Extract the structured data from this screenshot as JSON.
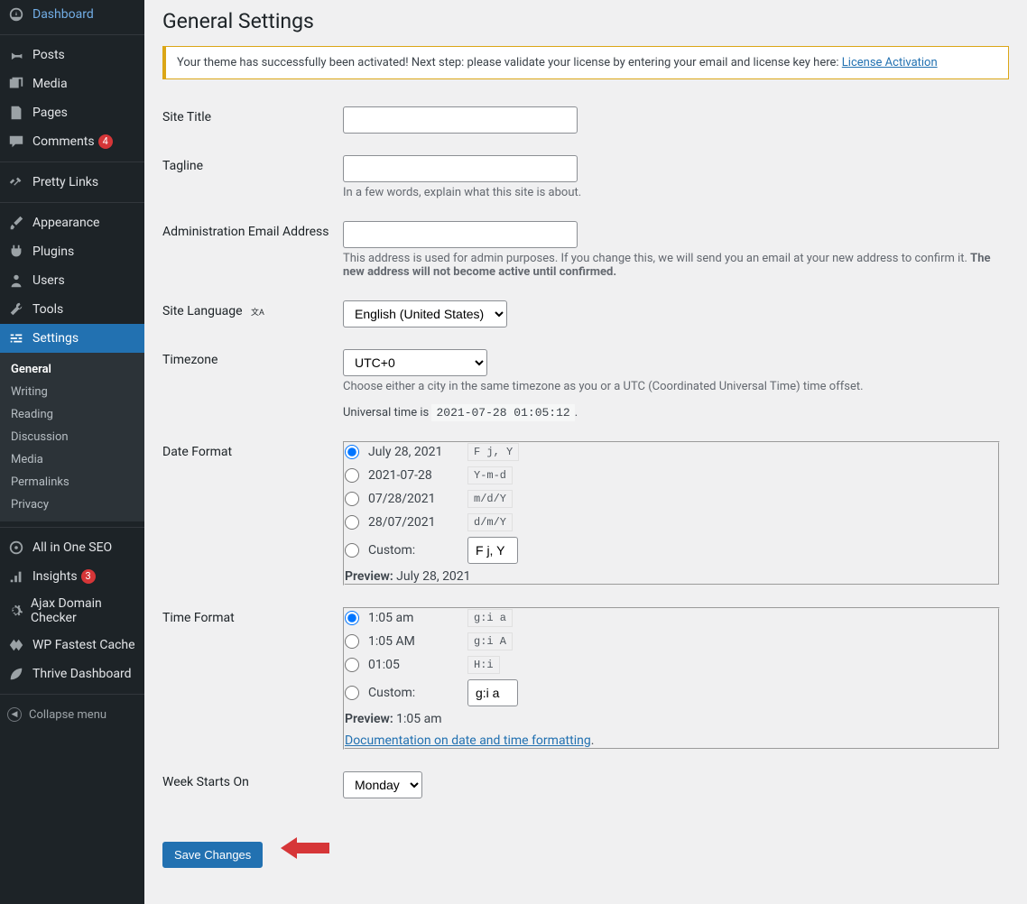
{
  "sidebar": {
    "items": [
      {
        "label": "Dashboard"
      },
      {
        "label": "Posts"
      },
      {
        "label": "Media"
      },
      {
        "label": "Pages"
      },
      {
        "label": "Comments",
        "badge": "4"
      },
      {
        "label": "Pretty Links"
      },
      {
        "label": "Appearance"
      },
      {
        "label": "Plugins"
      },
      {
        "label": "Users"
      },
      {
        "label": "Tools"
      },
      {
        "label": "Settings"
      }
    ],
    "submenu": [
      "General",
      "Writing",
      "Reading",
      "Discussion",
      "Media",
      "Permalinks",
      "Privacy"
    ],
    "lower": [
      {
        "label": "All in One SEO"
      },
      {
        "label": "Insights",
        "badge": "3"
      },
      {
        "label": "Ajax Domain Checker"
      },
      {
        "label": "WP Fastest Cache"
      },
      {
        "label": "Thrive Dashboard"
      }
    ],
    "collapse": "Collapse menu"
  },
  "page": {
    "title": "General Settings",
    "notice_text": "Your theme has successfully been activated! Next step: please validate your license by entering your email and license key here: ",
    "notice_link": "License Activation"
  },
  "fields": {
    "site_title": {
      "label": "Site Title",
      "value": ""
    },
    "tagline": {
      "label": "Tagline",
      "value": "",
      "desc": "In a few words, explain what this site is about."
    },
    "admin_email": {
      "label": "Administration Email Address",
      "value": "",
      "desc_pre": "This address is used for admin purposes. If you change this, we will send you an email at your new address to confirm it. ",
      "desc_strong": "The new address will not become active until confirmed."
    },
    "language": {
      "label": "Site Language",
      "value": "English (United States)"
    },
    "timezone": {
      "label": "Timezone",
      "value": "UTC+0",
      "desc": "Choose either a city in the same timezone as you or a UTC (Coordinated Universal Time) time offset.",
      "universal_pre": "Universal time is ",
      "universal_time": "2021-07-28 01:05:12",
      "universal_post": "."
    },
    "date_format": {
      "label": "Date Format",
      "options": [
        {
          "display": "July 28, 2021",
          "code": "F j, Y",
          "checked": true
        },
        {
          "display": "2021-07-28",
          "code": "Y-m-d"
        },
        {
          "display": "07/28/2021",
          "code": "m/d/Y"
        },
        {
          "display": "28/07/2021",
          "code": "d/m/Y"
        }
      ],
      "custom_label": "Custom:",
      "custom_value": "F j, Y",
      "preview_label": "Preview:",
      "preview_value": "July 28, 2021"
    },
    "time_format": {
      "label": "Time Format",
      "options": [
        {
          "display": "1:05 am",
          "code": "g:i a",
          "checked": true
        },
        {
          "display": "1:05 AM",
          "code": "g:i A"
        },
        {
          "display": "01:05",
          "code": "H:i"
        }
      ],
      "custom_label": "Custom:",
      "custom_value": "g:i a",
      "preview_label": "Preview:",
      "preview_value": "1:05 am",
      "doc_link": "Documentation on date and time formatting"
    },
    "week": {
      "label": "Week Starts On",
      "value": "Monday"
    }
  },
  "submit": {
    "label": "Save Changes"
  }
}
